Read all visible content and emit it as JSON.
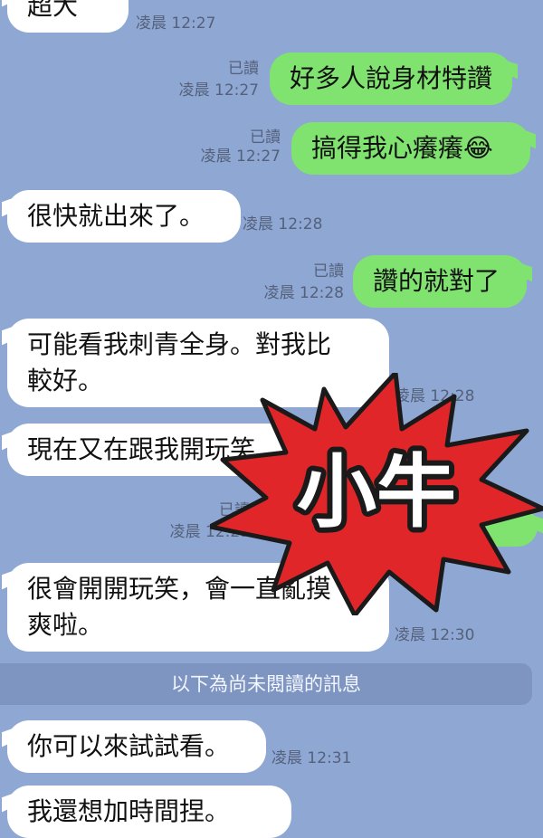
{
  "messages": [
    {
      "text": "超大",
      "time": "凌晨 12:27"
    },
    {
      "text": "好多人說身材特讚",
      "read": "已讀",
      "time": "凌晨 12:27"
    },
    {
      "text": "搞得我心癢癢😂",
      "read": "已讀",
      "time": "凌晨 12:27"
    },
    {
      "text": "很快就出來了。",
      "time": "凌晨 12:28"
    },
    {
      "text": "讚的就對了",
      "read": "已讀",
      "time": "凌晨 12:28"
    },
    {
      "line1": "可能看我刺青全身。對我比",
      "line2": "較好。",
      "time": "凌晨 12:28"
    },
    {
      "text": "現在又在跟我開玩笑",
      "time": ""
    },
    {
      "read": "已讀",
      "time": "凌晨 12:29"
    },
    {
      "line1": "很會開開玩笑，會一直亂摸",
      "line2": "爽啦。",
      "time": "凌晨 12:30"
    },
    {
      "text": "你可以來試試看。",
      "time": "凌晨 12:31"
    },
    {
      "text": "我還想加時間捏。"
    }
  ],
  "unread_divider": "以下為尚未閱讀的訊息",
  "sticker": {
    "text": "小牛",
    "color": "#e1262a"
  }
}
